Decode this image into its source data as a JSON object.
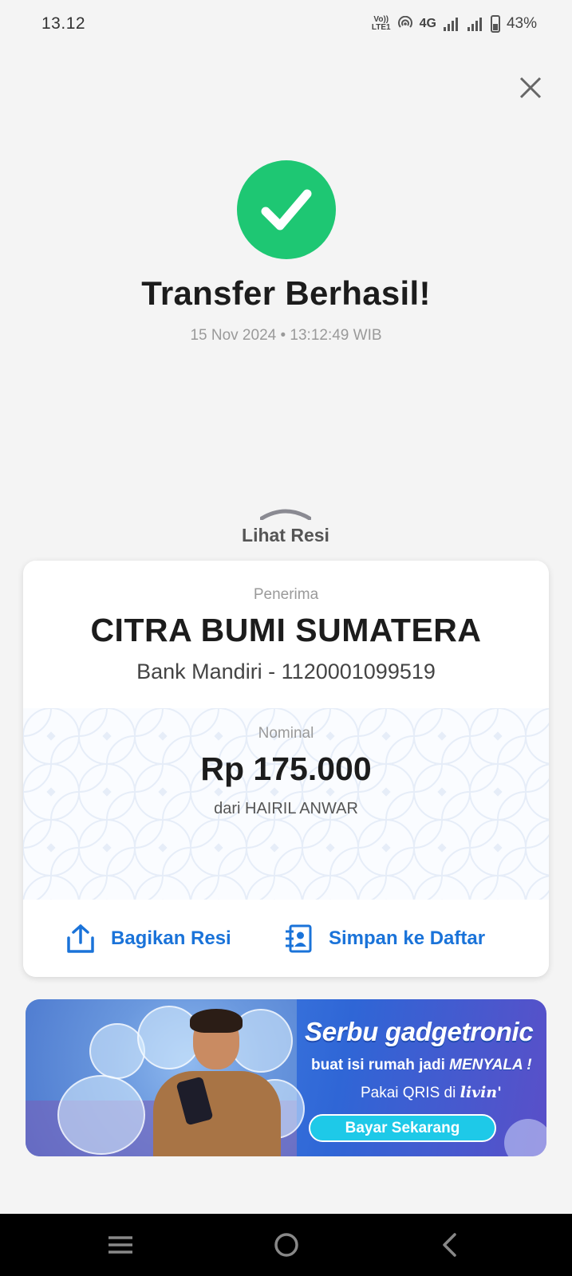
{
  "status_bar": {
    "time": "13.12",
    "volte_line1": "Vo))",
    "volte_line2": "LTE1",
    "network": "4G",
    "battery": "43%",
    "battery_level": 0.43
  },
  "success": {
    "title": "Transfer Berhasil!",
    "datetime": "15 Nov 2024 • 13:12:49 WIB"
  },
  "receipt_toggle": {
    "label": "Lihat Resi"
  },
  "receipt": {
    "recipient_label": "Penerima",
    "recipient_name": "CITRA BUMI SUMATERA",
    "recipient_account": "Bank Mandiri - 1120001099519",
    "amount_label": "Nominal",
    "amount": "Rp 175.000",
    "from": "dari HAIRIL ANWAR"
  },
  "actions": {
    "share_label": "Bagikan Resi",
    "save_label": "Simpan ke Daftar"
  },
  "banner": {
    "title": "Serbu gadgetronic",
    "subtitle_prefix": "buat isi rumah jadi",
    "subtitle_highlight": "MENYALA !",
    "qris_prefix": "Pakai QRIS di",
    "brand": "livin'",
    "button_label": "Bayar Sekarang"
  },
  "colors": {
    "success_green": "#1ec773",
    "action_blue": "#1a73d9",
    "background": "#f4f4f4"
  },
  "icons": {
    "close": "close-icon",
    "success": "checkmark-icon",
    "share": "share-icon",
    "save": "contact-add-icon",
    "nav_menu": "recent-apps-icon",
    "nav_home": "home-icon",
    "nav_back": "back-icon"
  }
}
